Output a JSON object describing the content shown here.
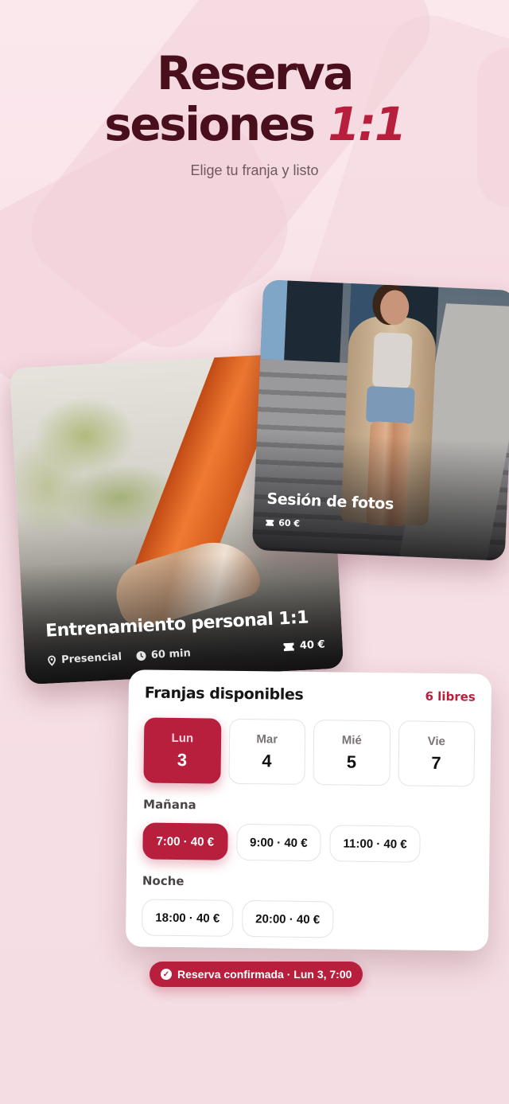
{
  "hero": {
    "title_line1": "Reserva",
    "title_line2": "sesiones",
    "title_accent": "1:1",
    "subtitle": "Elige tu franja y listo"
  },
  "training_card": {
    "title": "Entrenamiento personal 1:1",
    "location": "Presencial",
    "duration": "60 min",
    "price": "40 €",
    "icons": {
      "location": "location-pin-icon",
      "duration": "clock-icon",
      "price": "ticket-icon"
    }
  },
  "photo_card": {
    "title": "Sesión de fotos",
    "price": "60 €",
    "icons": {
      "price": "ticket-icon"
    }
  },
  "slots": {
    "title": "Franjas disponibles",
    "free_count": "6 libres",
    "days": [
      {
        "name": "Lun",
        "num": "3",
        "selected": true
      },
      {
        "name": "Mar",
        "num": "4",
        "selected": false
      },
      {
        "name": "Mié",
        "num": "5",
        "selected": false
      },
      {
        "name": "Vie",
        "num": "7",
        "selected": false
      }
    ],
    "groups": [
      {
        "label": "Mañana",
        "times": [
          "7:00 · 40 €",
          "9:00 · 40 €",
          "11:00 · 40 €"
        ]
      },
      {
        "label": "Noche",
        "times": [
          "18:00 · 40 €",
          "20:00 · 40 €"
        ]
      }
    ],
    "selected_time": "7:00 · 40 €"
  },
  "confirmation": {
    "text": "Reserva confirmada · Lun 3, 7:00",
    "icon": "check-circle-icon"
  },
  "colors": {
    "accent": "#b81f3d",
    "title": "#4a0f1c",
    "background": "#fbe8ed"
  }
}
